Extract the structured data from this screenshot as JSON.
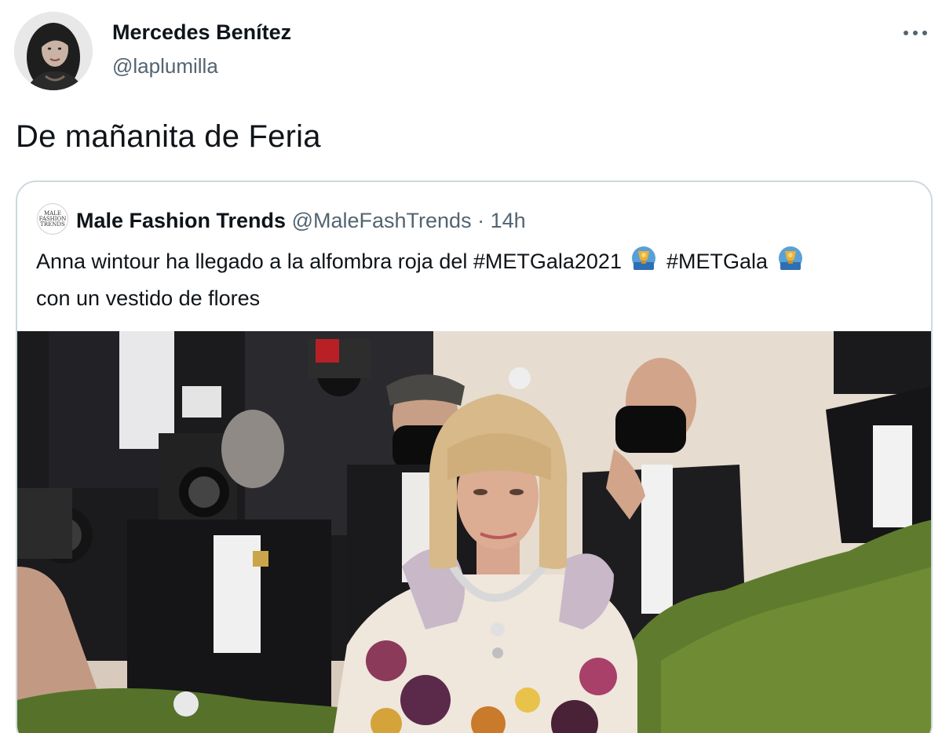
{
  "author": {
    "name": "Mercedes Benítez",
    "handle": "@laplumilla"
  },
  "tweet": {
    "text": "De mañanita de Feria"
  },
  "more_icon": "more-horizontal-icon",
  "quoted": {
    "avatar_text": "MALE FASHION TRENDS",
    "name": "Male Fashion Trends",
    "handle": "@MaleFashTrends",
    "separator": "·",
    "time": "14h",
    "text_part1": "Anna wintour ha llegado a la alfombra roja del #METGala2021",
    "text_part2": "#METGala",
    "text_line2": "con un vestido de flores",
    "emoji": "award-trophy-emoji"
  },
  "colors": {
    "text_primary": "#0f1419",
    "text_secondary": "#536471",
    "border": "#cfd9de"
  }
}
